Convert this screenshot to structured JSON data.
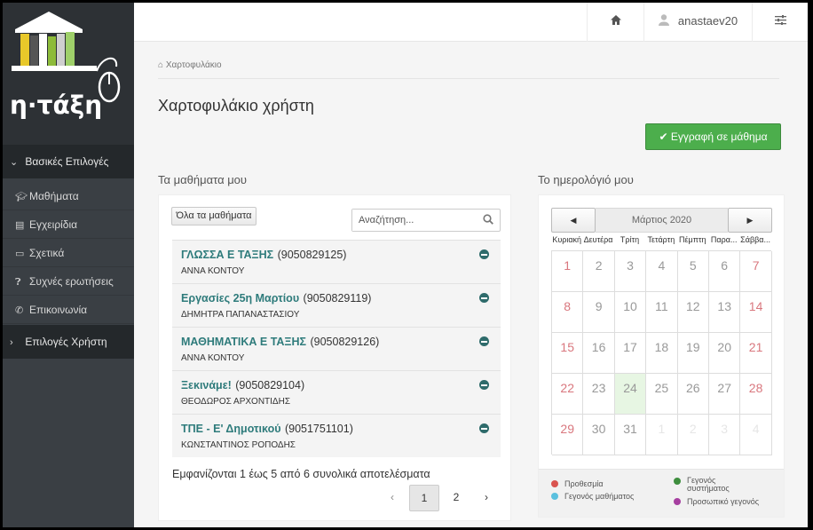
{
  "app": {
    "logo_text": "η·τάξη"
  },
  "colors": {
    "sidebar": "#3a3f44",
    "accent_green": "#4cae4c",
    "course_link": "#2e7b7b",
    "weekend_red": "#d9777e",
    "today_bg": "#e7f6e3"
  },
  "sidebar": {
    "section_main": "Βασικές Επιλογές",
    "items": [
      {
        "label": "Μαθήματα",
        "icon": "graduation-cap-icon"
      },
      {
        "label": "Εγχειρίδια",
        "icon": "file-icon"
      },
      {
        "label": "Σχετικά",
        "icon": "credit-card-icon"
      },
      {
        "label": "Συχνές ερωτήσεις",
        "icon": "question-circle-icon"
      },
      {
        "label": "Επικοινωνία",
        "icon": "phone-icon"
      }
    ],
    "section_user": "Επιλογές Χρήστη"
  },
  "topbar": {
    "home_icon": "home-icon",
    "username": "anastaev20",
    "settings_icon": "sliders-icon"
  },
  "breadcrumb": {
    "icon": "home-icon",
    "label": "Χαρτοφυλάκιο"
  },
  "page": {
    "title": "Χαρτοφυλάκιο χρήστη",
    "enroll_button": "Εγγραφή σε μάθημα"
  },
  "courses": {
    "section_title": "Τα μαθήματα μου",
    "all_button": "Όλα τα μαθήματα",
    "search_placeholder": "Αναζήτηση...",
    "items": [
      {
        "title": "ΓΛΩΣΣΑ Ε ΤΑΞΗΣ",
        "code": "(9050829125)",
        "teacher": "ΑΝΝΑ ΚΟΝΤΟΥ"
      },
      {
        "title": "Εργασίες 25η Μαρτίου",
        "code": "(9050829119)",
        "teacher": "ΔΗΜΗΤΡΑ ΠΑΠΑΝΑΣΤΑΣΙΟΥ"
      },
      {
        "title": "ΜΑΘΗΜΑΤΙΚΑ Ε ΤΑΞΗΣ",
        "code": "(9050829126)",
        "teacher": "ΑΝΝΑ ΚΟΝΤΟΥ"
      },
      {
        "title": "Ξεκινάμε!",
        "code": "(9050829104)",
        "teacher": "ΘΕΟΔΩΡΟΣ ΑΡΧΟΝΤΙΔΗΣ"
      },
      {
        "title": "ΤΠΕ - Ε' Δημοτικού",
        "code": "(9051751101)",
        "teacher": "ΚΩΝΣΤΑΝΤΙΝΟΣ ΡΟΠΟΔΗΣ"
      }
    ],
    "results_text": "Εμφανίζονται 1 έως 5 από 6 συνολικά αποτελέσματα",
    "pagination": {
      "prev": "‹",
      "pages": [
        "1",
        "2"
      ],
      "next": "›",
      "current": "1"
    }
  },
  "calendar": {
    "section_title": "Το ημερολόγιό μου",
    "prev": "◀",
    "next": "▶",
    "month": "Μάρτιος 2020",
    "weekdays": [
      "Κυριακή",
      "Δευτέρα",
      "Τρίτη",
      "Τετάρτη",
      "Πέμπτη",
      "Παρα...",
      "Σάββα..."
    ],
    "weeks": [
      [
        "1",
        "2",
        "3",
        "4",
        "5",
        "6",
        "7"
      ],
      [
        "8",
        "9",
        "10",
        "11",
        "12",
        "13",
        "14"
      ],
      [
        "15",
        "16",
        "17",
        "18",
        "19",
        "20",
        "21"
      ],
      [
        "22",
        "23",
        "24",
        "25",
        "26",
        "27",
        "28"
      ],
      [
        "29",
        "30",
        "31",
        "1",
        "2",
        "3",
        "4"
      ]
    ],
    "today": "24",
    "legend": [
      {
        "label": "Προθεσμία",
        "color": "#d9534f"
      },
      {
        "label": "Γεγονός μαθήματος",
        "color": "#5bc0de"
      },
      {
        "label": "Γεγονός συστήματος",
        "color": "#3e8e3e"
      },
      {
        "label": "Προσωπικό γεγονός",
        "color": "#a63fa0"
      }
    ]
  }
}
